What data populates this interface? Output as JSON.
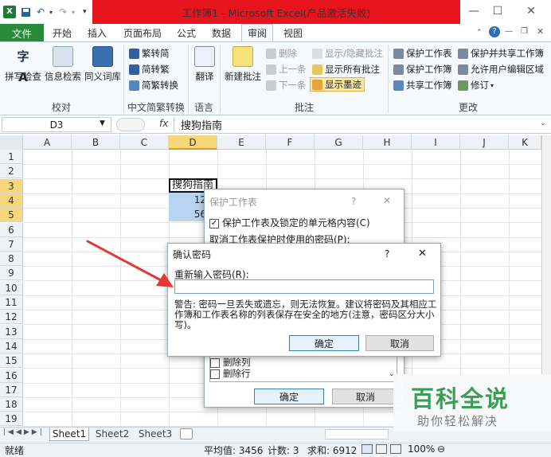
{
  "titlebar": {
    "title": "工作簿1 - Microsoft Excel(产品激活失败)",
    "minimize": "—",
    "maximize": "☐",
    "close": "✕"
  },
  "tabs": {
    "file": "文件",
    "items": [
      "开始",
      "插入",
      "页面布局",
      "公式",
      "数据",
      "审阅",
      "视图"
    ]
  },
  "ribbon": {
    "proofing": {
      "spell": "拼写检查",
      "research": "信息检索",
      "thesaurus": "同义词库",
      "label": "校对"
    },
    "chinese": {
      "to_trad": "繁转简",
      "to_simp": "简转繁",
      "convert": "简繁转换",
      "label": "中文简繁转换"
    },
    "language": {
      "translate": "翻译",
      "label": "语言"
    },
    "comments": {
      "new": "新建批注",
      "delete": "删除",
      "prev": "上一条",
      "next": "下一条",
      "show_hide": "显示/隐藏批注",
      "show_all": "显示所有批注",
      "show_ink": "显示墨迹",
      "label": "批注"
    },
    "changes": {
      "protect_sheet": "保护工作表",
      "protect_workbook": "保护工作簿",
      "share_workbook": "共享工作簿",
      "protect_share": "保护并共享工作簿",
      "allow_edit": "允许用户编辑区域",
      "track": "修订",
      "label": "更改"
    }
  },
  "formula_bar": {
    "name_box": "D3",
    "fx": "fx",
    "content": "搜狗指南"
  },
  "grid": {
    "columns": [
      "A",
      "B",
      "C",
      "D",
      "E",
      "F",
      "G",
      "H",
      "I",
      "J",
      "K"
    ],
    "rows": [
      "1",
      "2",
      "3",
      "4",
      "5",
      "6",
      "7",
      "8",
      "9",
      "10",
      "11",
      "12",
      "13",
      "14",
      "15",
      "16",
      "17",
      "18",
      "19"
    ],
    "cells": {
      "D3": "搜狗指南",
      "D4": "12",
      "D5": "56"
    }
  },
  "protect_dialog": {
    "title": "保护工作表",
    "help": "?",
    "close": "✕",
    "protect_check": "保护工作表及锁定的单元格内容(C)",
    "password_label": "取消工作表保护时使用的密码(P):",
    "list": [
      "删除列",
      "删除行"
    ],
    "ok": "确定",
    "cancel": "取消"
  },
  "confirm_dialog": {
    "title": "确认密码",
    "help": "?",
    "close": "✕",
    "label": "重新输入密码(R):",
    "value": "",
    "warning": "警告: 密码一旦丢失或遗忘，则无法恢复。建议将密码及其相应工作簿和工作表名称的列表保存在安全的地方(注意，密码区分大小写)。",
    "ok": "确定",
    "cancel": "取消"
  },
  "sheets": [
    "Sheet1",
    "Sheet2",
    "Sheet3"
  ],
  "status": {
    "ready": "就绪",
    "average": "平均值: 3456",
    "count": "计数: 3",
    "sum": "求和: 6912",
    "zoom": "100%"
  },
  "watermark": {
    "title": "百科全说",
    "subtitle": "助你轻松解决"
  },
  "colors": {
    "excel_green": "#2a8a3c",
    "title_red": "#e8141e",
    "arrow_red": "#e53935",
    "selection_blue": "#b7d4f0"
  }
}
